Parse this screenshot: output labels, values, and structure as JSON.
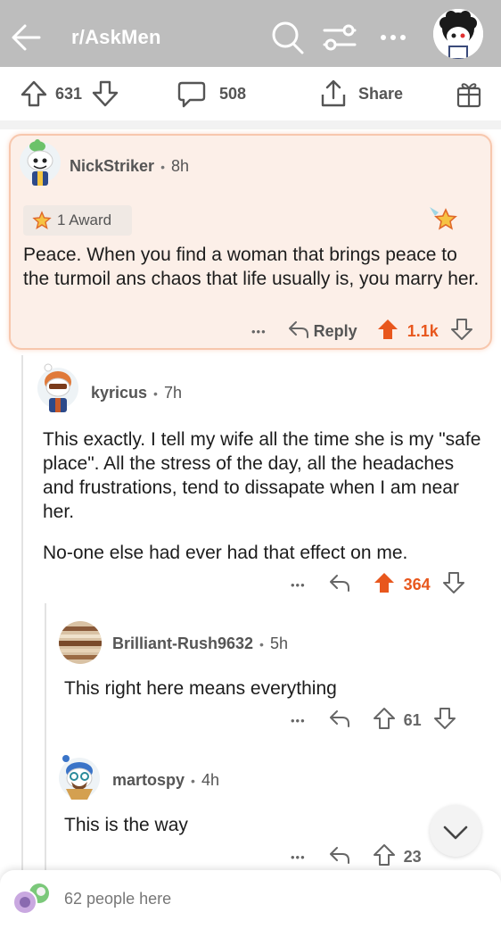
{
  "header": {
    "subreddit": "r/AskMen",
    "icons": [
      "back-arrow-icon",
      "search-icon",
      "filter-icon",
      "more-icon",
      "user-avatar"
    ]
  },
  "post_actions": {
    "upvotes": "631",
    "comments": "508",
    "share_label": "Share",
    "icons": [
      "upvote-icon",
      "downvote-icon",
      "comment-icon",
      "share-icon",
      "gift-icon"
    ]
  },
  "comments": [
    {
      "author": "NickStriker",
      "age": "8h",
      "award": "1 Award",
      "text": "Peace. When you find a woman that brings peace to the turmoil ans chaos that life usually is, you marry her.",
      "reply_label": "Reply",
      "score": "1.1k"
    },
    {
      "author": "kyricus",
      "age": "7h",
      "text_p1": "This exactly. I tell my wife all the time she is my \"safe place\".  All the stress of the day, all the headaches and frustrations, tend to dissapate when I am near her.",
      "text_p2": "No-one else had ever had that effect on me.",
      "score": "364"
    },
    {
      "author": "Brilliant-Rush9632",
      "age": "5h",
      "text": "This right here means everything",
      "score": "61"
    },
    {
      "author": "martospy",
      "age": "4h",
      "text": "This is the way",
      "score": "23"
    }
  ],
  "more_dots": "•••",
  "bottom_bar": {
    "people_here": "62 people here"
  },
  "colors": {
    "header_bg": "#bdbdbd",
    "upvote_active": "#e8571d",
    "highlight_bg": "#fcefe8",
    "highlight_border": "#f7c7ad"
  }
}
